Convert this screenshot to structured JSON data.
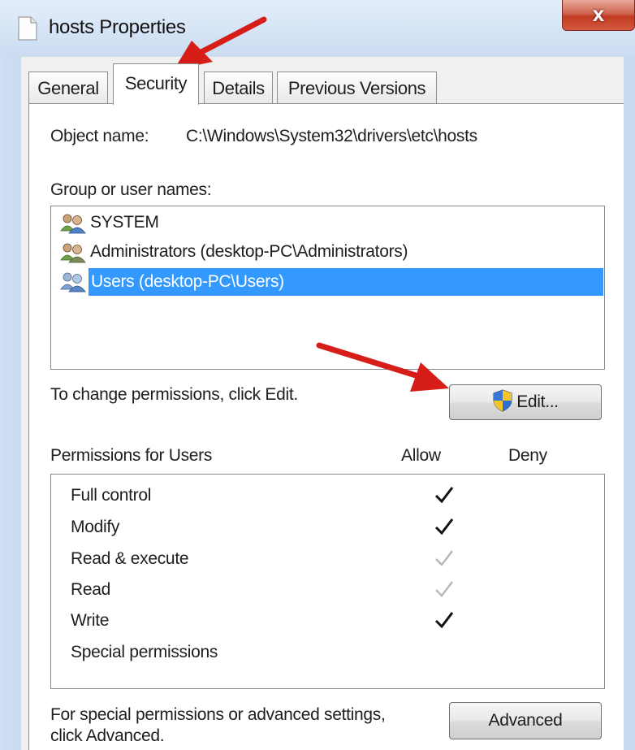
{
  "window": {
    "title": "hosts Properties",
    "close_label": "x",
    "title_icon": "document-icon"
  },
  "tabs": [
    {
      "label": "General",
      "active": false
    },
    {
      "label": "Security",
      "active": true
    },
    {
      "label": "Details",
      "active": false
    },
    {
      "label": "Previous Versions",
      "active": false
    }
  ],
  "security": {
    "object_name_label": "Object name:",
    "object_name_value": "C:\\Windows\\System32\\drivers\\etc\\hosts",
    "group_label": "Group or user names:",
    "groups": [
      {
        "name": "SYSTEM",
        "icon": "users-icon",
        "selected": false
      },
      {
        "name": "Administrators (desktop-PC\\Administrators)",
        "icon": "users-icon",
        "selected": false
      },
      {
        "name": "Users (desktop-PC\\Users)",
        "icon": "users-icon",
        "selected": true
      }
    ],
    "change_hint": "To change permissions, click Edit.",
    "edit_button": "Edit...",
    "edit_icon": "uac-shield-icon",
    "permissions_label": "Permissions for Users",
    "allow_header": "Allow",
    "deny_header": "Deny",
    "permissions": [
      {
        "name": "Full control",
        "allow": "explicit",
        "deny": "none"
      },
      {
        "name": "Modify",
        "allow": "explicit",
        "deny": "none"
      },
      {
        "name": "Read & execute",
        "allow": "inherited",
        "deny": "none"
      },
      {
        "name": "Read",
        "allow": "inherited",
        "deny": "none"
      },
      {
        "name": "Write",
        "allow": "explicit",
        "deny": "none"
      },
      {
        "name": "Special permissions",
        "allow": "none",
        "deny": "none"
      }
    ],
    "advanced_hint_line1": "For special permissions or advanced settings,",
    "advanced_hint_line2": "click Advanced.",
    "advanced_button": "Advanced"
  },
  "colors": {
    "selection": "#3399ff",
    "annotation_arrow": "#e0201b",
    "check_explicit": "#111111",
    "check_inherited": "#b8b8b8"
  }
}
